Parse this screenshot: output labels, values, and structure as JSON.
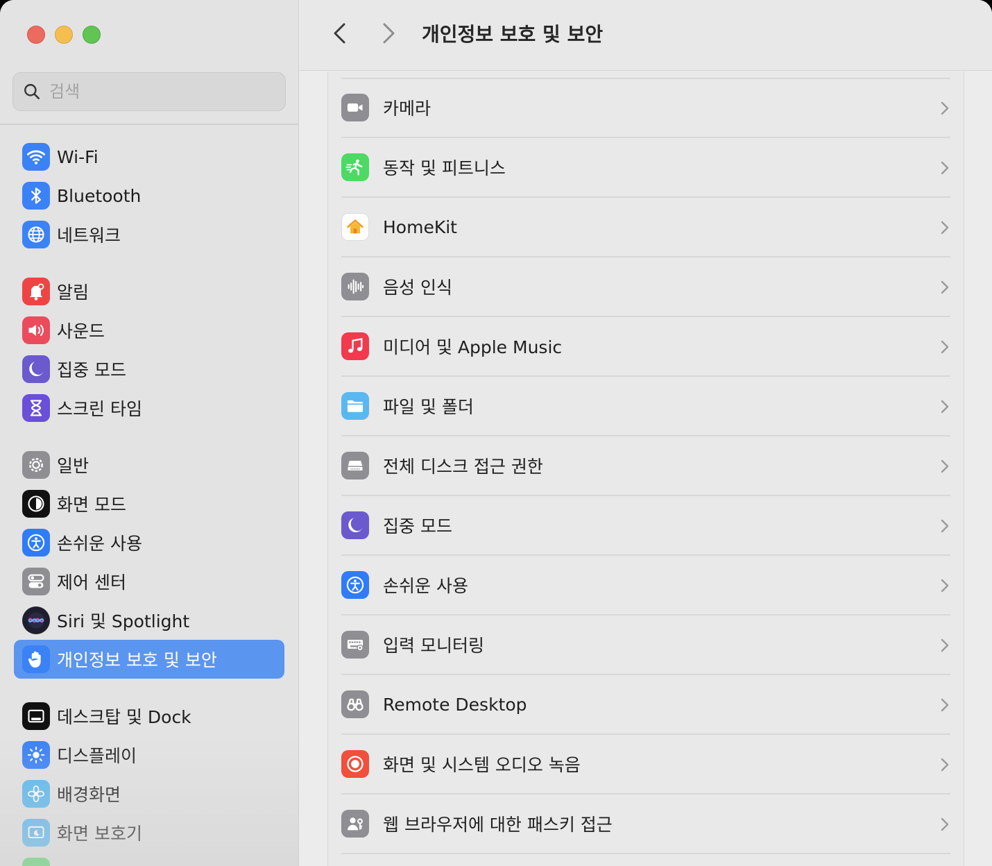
{
  "search": {
    "placeholder": "검색"
  },
  "sidebar": {
    "items": [
      {
        "label": "Wi-Fi",
        "icon": "wifi-icon",
        "color": "#3b82f6"
      },
      {
        "label": "Bluetooth",
        "icon": "bluetooth-icon",
        "color": "#3b82f6"
      },
      {
        "label": "네트워크",
        "icon": "globe-icon",
        "color": "#3b82f6"
      },
      {
        "label": "알림",
        "icon": "bell-icon",
        "color": "#ef4444"
      },
      {
        "label": "사운드",
        "icon": "speaker-icon",
        "color": "#ec4b5c"
      },
      {
        "label": "집중 모드",
        "icon": "moon-icon",
        "color": "#6a5acd"
      },
      {
        "label": "스크린 타임",
        "icon": "hourglass-icon",
        "color": "#6a4fd8"
      },
      {
        "label": "일반",
        "icon": "gear-icon",
        "color": "#8e8e93"
      },
      {
        "label": "화면 모드",
        "icon": "appearance-icon",
        "color": "#111111"
      },
      {
        "label": "손쉬운 사용",
        "icon": "accessibility-icon",
        "color": "#2f7cf6"
      },
      {
        "label": "제어 센터",
        "icon": "toggles-icon",
        "color": "#8e8e93"
      },
      {
        "label": "Siri 및 Spotlight",
        "icon": "siri-icon",
        "color": "#1e1e2e"
      },
      {
        "label": "개인정보 보호 및 보안",
        "icon": "hand-icon",
        "color": "#3b82f6"
      },
      {
        "label": "데스크탑 및 Dock",
        "icon": "dock-icon",
        "color": "#111111"
      },
      {
        "label": "디스플레이",
        "icon": "sun-icon",
        "color": "#3b82f6"
      },
      {
        "label": "배경화면",
        "icon": "flower-icon",
        "color": "#5ab8f0"
      },
      {
        "label": "화면 보호기",
        "icon": "screensaver-icon",
        "color": "#5ab8f0"
      }
    ]
  },
  "header": {
    "title": "개인정보 보호 및 보안"
  },
  "rows": [
    {
      "label": "카메라",
      "icon": "camera-icon",
      "color": "#8e8e93"
    },
    {
      "label": "동작 및 피트니스",
      "icon": "running-icon",
      "color": "#4cd964"
    },
    {
      "label": "HomeKit",
      "icon": "home-icon",
      "color": "#ffffff"
    },
    {
      "label": "음성 인식",
      "icon": "waveform-icon",
      "color": "#8e8e93"
    },
    {
      "label": "미디어 및 Apple Music",
      "icon": "music-note-icon",
      "color": "#f2394d"
    },
    {
      "label": "파일 및 폴더",
      "icon": "folder-icon",
      "color": "#5ab8f0"
    },
    {
      "label": "전체 디스크 접근 권한",
      "icon": "disk-icon",
      "color": "#8e8e93"
    },
    {
      "label": "집중 모드",
      "icon": "moon-icon",
      "color": "#6a5acd"
    },
    {
      "label": "손쉬운 사용",
      "icon": "accessibility-icon",
      "color": "#2f7cf6"
    },
    {
      "label": "입력 모니터링",
      "icon": "keyboard-icon",
      "color": "#8e8e93"
    },
    {
      "label": "Remote Desktop",
      "icon": "binoculars-icon",
      "color": "#8e8e93"
    },
    {
      "label": "화면 및 시스템 오디오 녹음",
      "icon": "record-icon",
      "color": "#f0503c"
    },
    {
      "label": "웹 브라우저에 대한 패스키 접근",
      "icon": "person-key-icon",
      "color": "#8e8e93"
    }
  ]
}
